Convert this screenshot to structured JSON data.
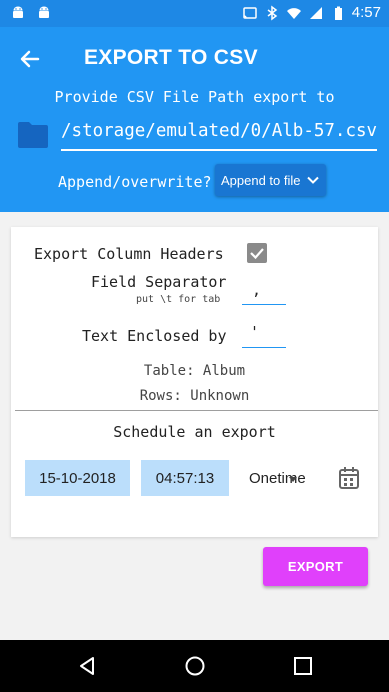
{
  "status_bar": {
    "time": "4:57",
    "icons": [
      "android-icon",
      "android-icon",
      "cast-icon",
      "bluetooth-icon",
      "wifi-icon",
      "signal-icon",
      "battery-icon"
    ]
  },
  "header": {
    "title": "EXPORT TO CSV",
    "provide_label": "Provide CSV File Path export to",
    "file_path": "/storage/emulated/0/Alb-57.csv",
    "append_label": "Append/overwrite?",
    "append_option": "Append to file"
  },
  "options": {
    "export_headers_label": "Export Column Headers",
    "export_headers_checked": true,
    "field_separator_label": "Field Separator",
    "field_separator_hint": "put \\t for tab",
    "field_separator_value": ",",
    "text_enclosed_label": "Text Enclosed by",
    "text_enclosed_value": "'",
    "table_info": "Table: Album",
    "rows_info": "Rows: Unknown"
  },
  "schedule": {
    "label": "Schedule an export",
    "date": "15-10-2018",
    "time": "04:57:13",
    "frequency": "Onetime"
  },
  "actions": {
    "export_label": "EXPORT"
  },
  "colors": {
    "status_bar": "#1e88e5",
    "header": "#2196f3",
    "accent": "#e040fb",
    "date_box": "#bbdefb"
  }
}
